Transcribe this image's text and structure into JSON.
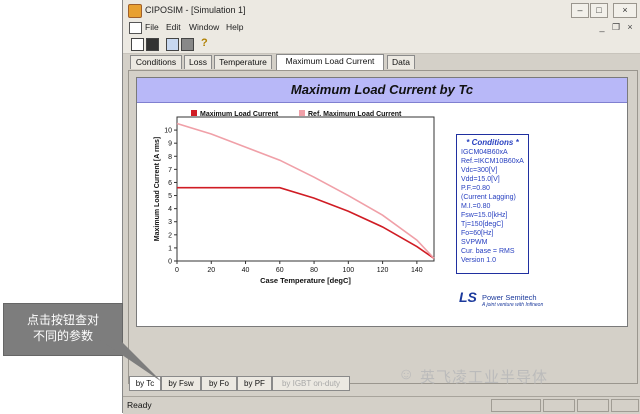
{
  "window": {
    "title": "CIPOSIM - [Simulation 1]",
    "controls": {
      "minimize": "–",
      "maximize": "□",
      "close": "×"
    }
  },
  "menu": [
    "File",
    "Edit",
    "Window",
    "Help"
  ],
  "mdi_controls": {
    "minimize": "_",
    "restore": "❐",
    "close": "×"
  },
  "toolbar_icons": [
    "new-icon",
    "save-icon",
    "copy-icon",
    "print-icon",
    "help-icon"
  ],
  "tabs_top": [
    {
      "label": "Conditions"
    },
    {
      "label": "Loss"
    },
    {
      "label": "Temperature"
    },
    {
      "label": "Maximum Load Current",
      "active": true
    },
    {
      "label": "Data"
    }
  ],
  "conditions": {
    "title": "* Conditions *",
    "lines": [
      "IGCM04B60xA",
      "Ref.=IKCM10B60xA",
      "Vdc=300[V]",
      "Vdd=15.0[V]",
      "P.F.=0.80",
      "(Current Lagging)",
      "M.I.=0.80",
      "Fsw=15.0[kHz]",
      "Tj=150[degC]",
      "Fo=60[Hz]",
      "SVPWM",
      "Cur. base = RMS",
      "Version 1.0"
    ]
  },
  "logo": {
    "mark": "LS",
    "name": "Power Semitech",
    "tagline": "A joint venture with Infineon"
  },
  "tabs_bottom": [
    {
      "label": "by Tc",
      "active": true
    },
    {
      "label": "by Fsw"
    },
    {
      "label": "by Fo"
    },
    {
      "label": "by PF"
    },
    {
      "label": "by IGBT on-duty",
      "disabled": true
    }
  ],
  "status": {
    "text": "Ready"
  },
  "callout": {
    "text": "点击按钮查对\n不同的参数"
  },
  "watermark": {
    "text": "英飞凌工业半导体"
  },
  "colors": {
    "series_main": "#d01c24",
    "series_ref": "#f0a0a8",
    "header_band": "#b8b8f8",
    "conditions_text": "#2840c0"
  },
  "chart_data": {
    "type": "line",
    "title": "Maximum Load Current by Tc",
    "xlabel": "Case Temperature [degC]",
    "ylabel": "Maximum Load Current [A rms]",
    "xlim": [
      0,
      150
    ],
    "ylim": [
      0,
      11
    ],
    "xticks": [
      0,
      20,
      40,
      60,
      80,
      100,
      120,
      140
    ],
    "yticks": [
      0,
      1,
      2,
      3,
      4,
      5,
      6,
      7,
      8,
      9,
      10
    ],
    "legend_position": "top",
    "series": [
      {
        "name": "Maximum Load Current",
        "color": "#d01c24",
        "x": [
          0,
          20,
          40,
          60,
          80,
          100,
          120,
          140,
          150
        ],
        "y": [
          5.6,
          5.6,
          5.6,
          5.6,
          4.8,
          3.8,
          2.6,
          1.1,
          0.2
        ]
      },
      {
        "name": "Ref. Maximum Load Current",
        "color": "#f0a0a8",
        "x": [
          0,
          20,
          40,
          60,
          80,
          100,
          120,
          140,
          150
        ],
        "y": [
          10.5,
          9.7,
          8.7,
          7.7,
          6.4,
          5.0,
          3.5,
          1.6,
          0.2
        ]
      }
    ]
  }
}
